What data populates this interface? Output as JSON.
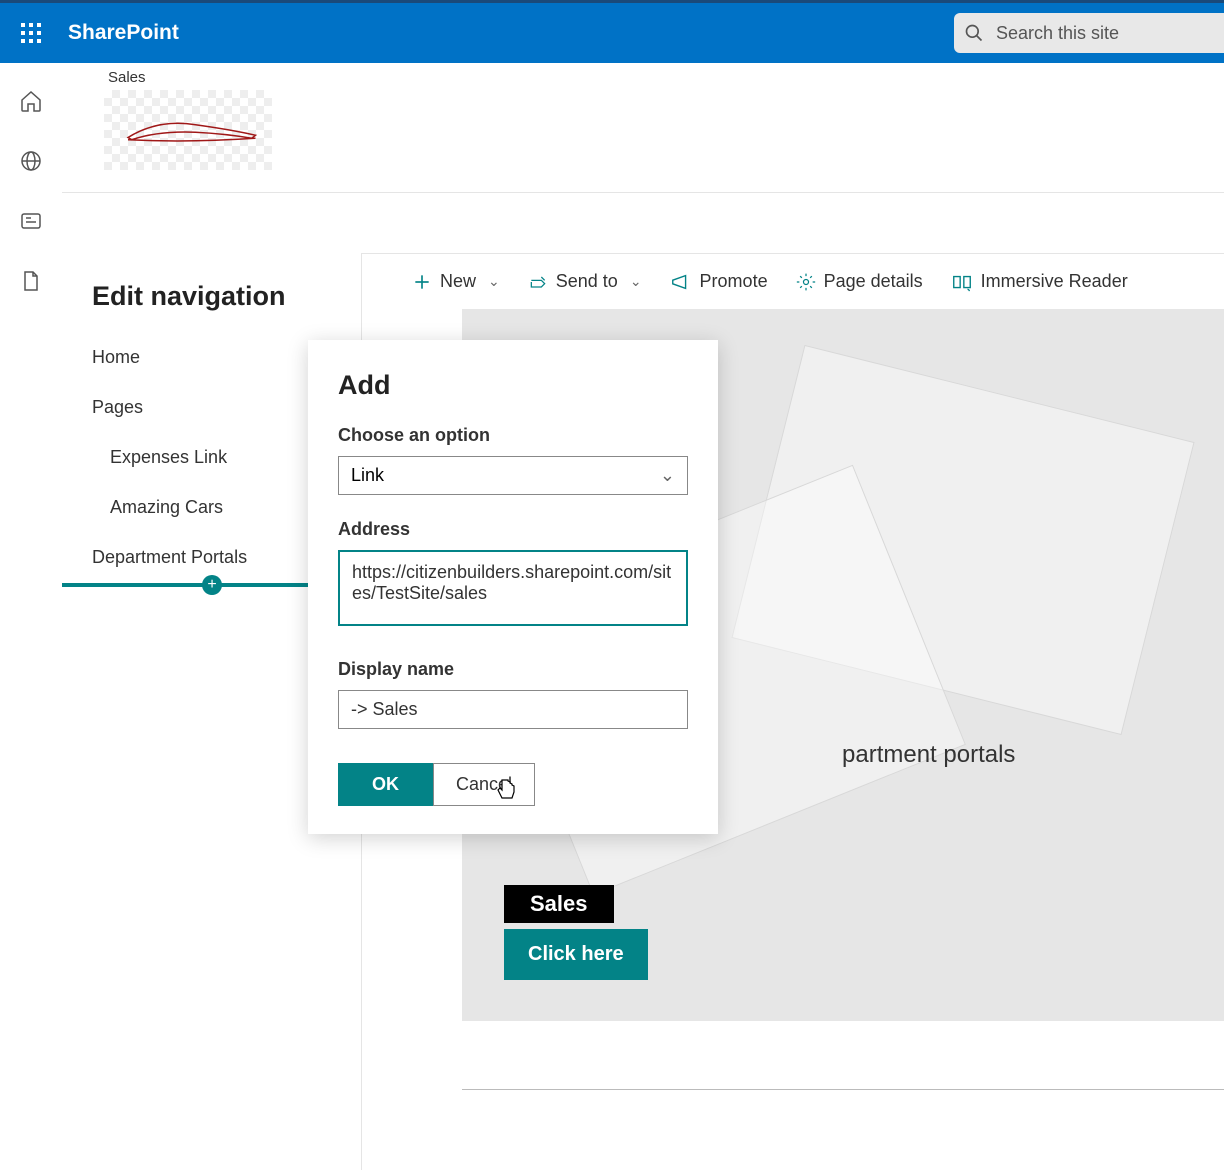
{
  "suite": {
    "brand": "SharePoint",
    "search_placeholder": "Search this site"
  },
  "site": {
    "title": "Sales"
  },
  "nav": {
    "title": "Edit navigation",
    "items": [
      {
        "label": "Home",
        "sub": false
      },
      {
        "label": "Pages",
        "sub": false
      },
      {
        "label": "Expenses Link",
        "sub": true
      },
      {
        "label": "Amazing Cars",
        "sub": true
      },
      {
        "label": "Department Portals",
        "sub": false
      }
    ]
  },
  "commands": {
    "new": "New",
    "send_to": "Send to",
    "promote": "Promote",
    "page_details": "Page details",
    "immersive_reader": "Immersive Reader"
  },
  "page": {
    "heading_fragment": "partment portals",
    "sales_badge": "Sales",
    "cta": "Click here"
  },
  "dialog": {
    "title": "Add",
    "option_label": "Choose an option",
    "option_value": "Link",
    "address_label": "Address",
    "address_value": "https://citizenbuilders.sharepoint.com/sites/TestSite/sales",
    "display_label": "Display name",
    "display_value": "-> Sales",
    "ok": "OK",
    "cancel": "Cancel"
  }
}
